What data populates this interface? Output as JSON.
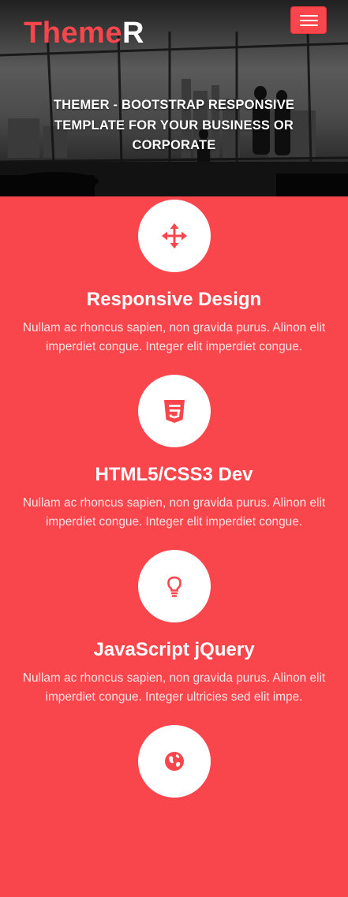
{
  "navbar": {
    "brand_main": "Theme",
    "brand_end": "R",
    "menu_icon": "hamburger-menu-icon"
  },
  "hero": {
    "title": "THEMER - BOOTSTRAP RESPONSIVE TEMPLATE FOR YOUR BUSINESS OR CORPORATE"
  },
  "colors": {
    "accent": "#f9464c",
    "white": "#ffffff"
  },
  "features": [
    {
      "icon": "move-arrows-icon",
      "title": "Responsive Design",
      "text": "Nullam ac rhoncus sapien, non gravida purus. Alinon elit imperdiet congue. Integer elit imperdiet congue."
    },
    {
      "icon": "css3-icon",
      "title": "HTML5/CSS3 Dev",
      "text": "Nullam ac rhoncus sapien, non gravida purus. Alinon elit imperdiet congue. Integer elit imperdiet congue."
    },
    {
      "icon": "lightbulb-icon",
      "title": "JavaScript jQuery",
      "text": "Nullam ac rhoncus sapien, non gravida purus. Alinon elit imperdiet congue. Integer ultricies sed elit impe."
    },
    {
      "icon": "globe-icon",
      "title": "",
      "text": ""
    }
  ]
}
